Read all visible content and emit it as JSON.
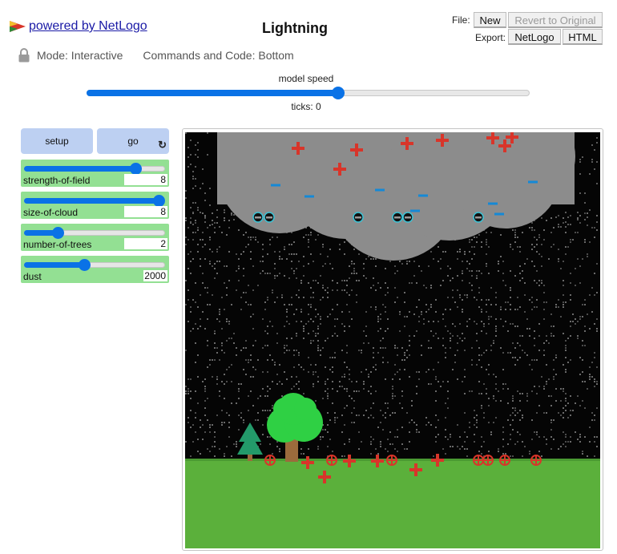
{
  "header": {
    "powered_by": "powered by NetLogo",
    "title": "Lightning",
    "file_label": "File:",
    "export_label": "Export:",
    "new_button": "New",
    "revert_button": "Revert to Original",
    "export_netlogo_button": "NetLogo",
    "export_html_button": "HTML",
    "mode_text": "Mode: Interactive",
    "commands_text": "Commands and Code: Bottom"
  },
  "speed": {
    "label": "model speed",
    "level": 0.57,
    "ticks_label": "ticks:",
    "ticks_value": "0"
  },
  "buttons": {
    "setup": "setup",
    "go": "go",
    "go_icon": "forever-icon"
  },
  "sliders": [
    {
      "name": "strength-of-field",
      "value": "8",
      "fraction": 0.82
    },
    {
      "name": "size-of-cloud",
      "value": "8",
      "fraction": 1.0
    },
    {
      "name": "number-of-trees",
      "value": "2",
      "fraction": 0.22
    },
    {
      "name": "dust",
      "value": "2000",
      "fraction": 0.42
    }
  ],
  "colors": {
    "accent": "#0a72e6",
    "button_bg": "#bdd0f2",
    "slider_bg": "#93e093",
    "sky": "#050505",
    "cloud": "#8c8c8c",
    "ground": "#5bb03b",
    "positive_charge": "#d8352a",
    "negative_charge": "#1589d6",
    "tree_leaves": "#2fd044",
    "pine": "#239a6a",
    "trunk": "#9b6b3c"
  }
}
